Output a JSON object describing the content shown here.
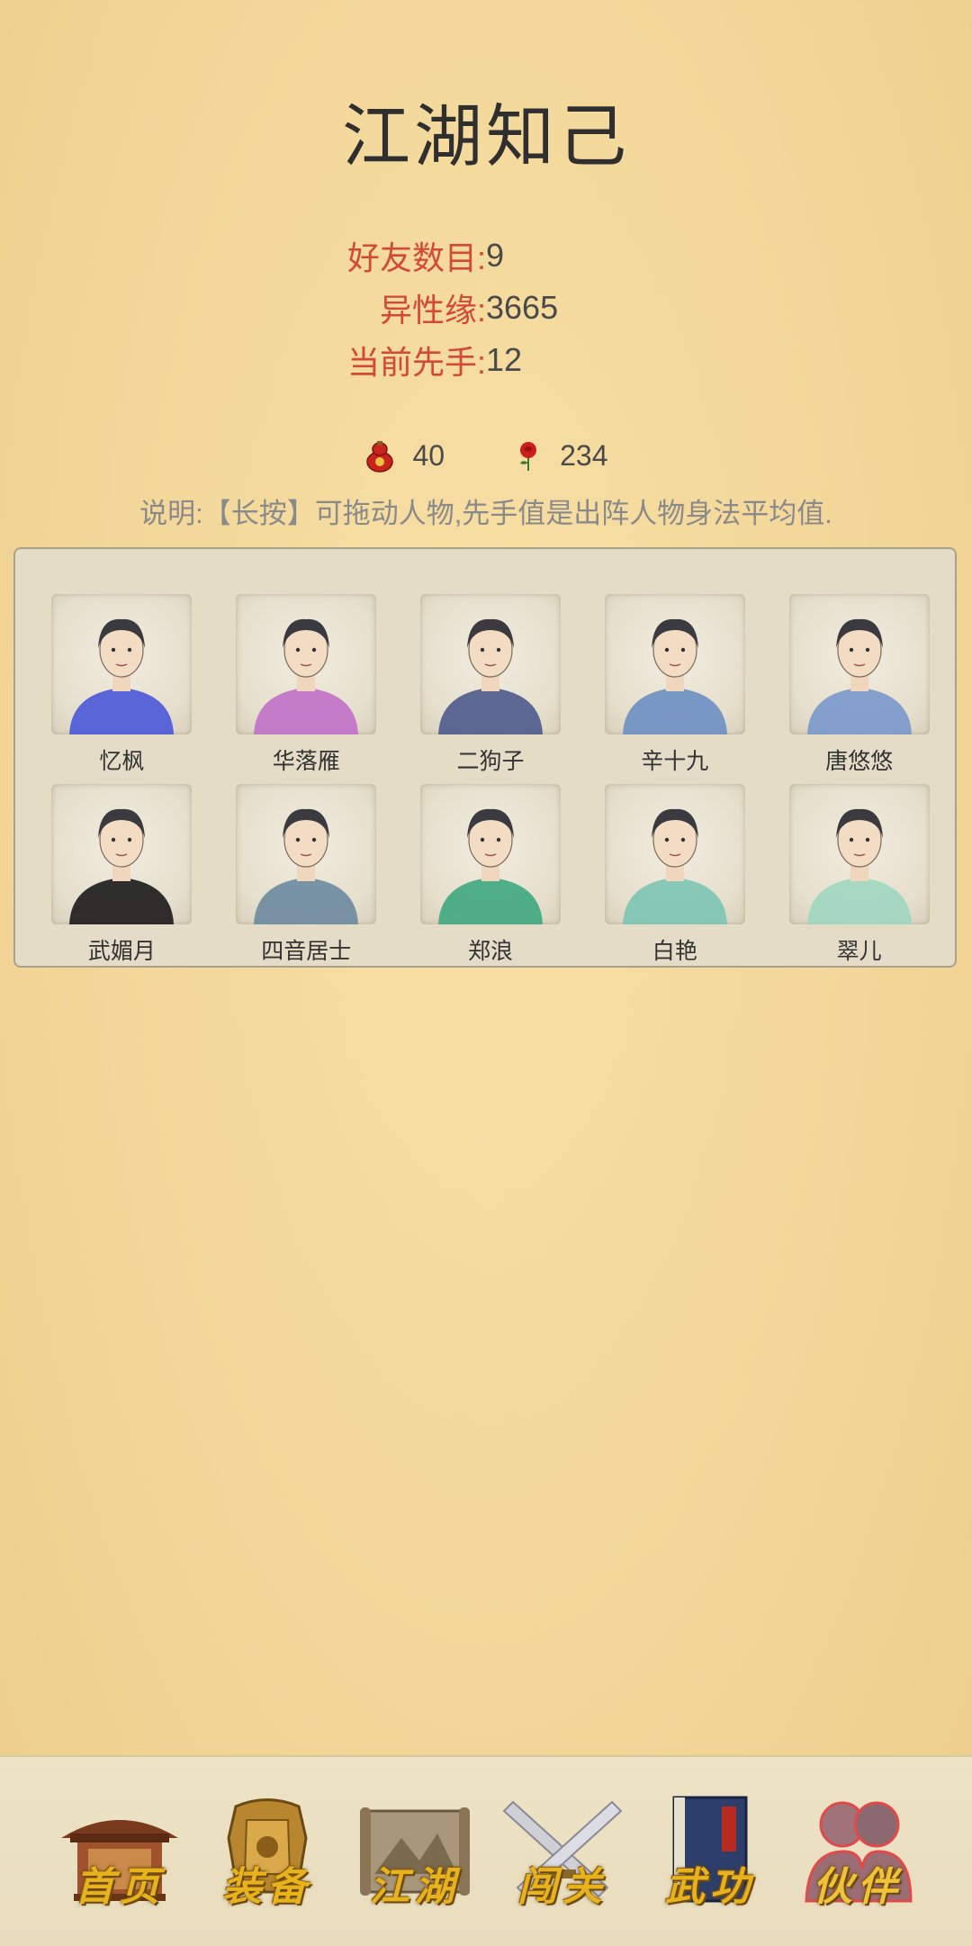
{
  "title": "江湖知己",
  "stats": [
    {
      "label": "好友数目:",
      "value": "9"
    },
    {
      "label": "异性缘:",
      "value": "3665"
    },
    {
      "label": "当前先手:",
      "value": "12"
    }
  ],
  "resources": {
    "gourd_icon": "gourd-icon",
    "gourd_count": "40",
    "rose_icon": "rose-icon",
    "rose_count": "234"
  },
  "note": "说明:【长按】可拖动人物,先手值是出阵人物身法平均值.",
  "friends": [
    {
      "name": "忆枫",
      "color": "#4a58d8"
    },
    {
      "name": "华落雁",
      "color": "#c070c8"
    },
    {
      "name": "二狗子",
      "color": "#4d5a8c"
    },
    {
      "name": "辛十九",
      "color": "#6b8fc2"
    },
    {
      "name": "唐悠悠",
      "color": "#7a98cc"
    },
    {
      "name": "武媚月",
      "color": "#1a1a1a"
    },
    {
      "name": "四音居士",
      "color": "#6b8aa0"
    },
    {
      "name": "郑浪",
      "color": "#3ea880"
    },
    {
      "name": "白艳",
      "color": "#7cc4b2"
    },
    {
      "name": "翠儿",
      "color": "#9ed6c0"
    }
  ],
  "nav": [
    {
      "label": "首页",
      "icon": "pavilion-icon"
    },
    {
      "label": "装备",
      "icon": "armor-icon"
    },
    {
      "label": "江湖",
      "icon": "scroll-map-icon"
    },
    {
      "label": "闯关",
      "icon": "crossed-swords-icon"
    },
    {
      "label": "武功",
      "icon": "book-icon"
    },
    {
      "label": "伙伴",
      "icon": "companions-icon"
    }
  ],
  "colors": {
    "accent_label": "#d24a36",
    "nav_text": "#e8b21c"
  }
}
